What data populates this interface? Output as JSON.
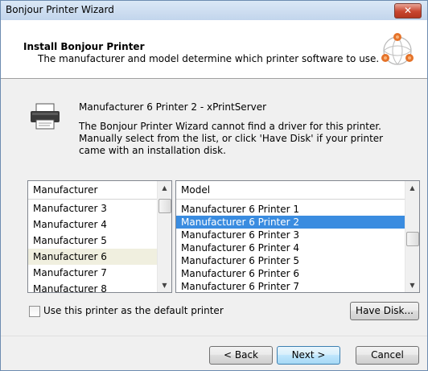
{
  "window": {
    "title": "Bonjour Printer Wizard",
    "close_label": "✕"
  },
  "header": {
    "title": "Install Bonjour Printer",
    "subtitle": "The manufacturer and model determine which printer software to use."
  },
  "printer": {
    "name": "Manufacturer 6 Printer 2 - xPrintServer",
    "description": "The Bonjour Printer Wizard cannot find a driver for this printer.  Manually select from the list, or click 'Have Disk' if your printer came with an installation disk."
  },
  "manufacturer_list": {
    "header": "Manufacturer",
    "items": [
      "Manufacturer 3",
      "Manufacturer 4",
      "Manufacturer 5",
      "Manufacturer 6",
      "Manufacturer 7",
      "Manufacturer 8"
    ],
    "selected": "Manufacturer 6"
  },
  "model_list": {
    "header": "Model",
    "items": [
      "Manufacturer 6 Printer 1",
      "Manufacturer 6 Printer 2",
      "Manufacturer 6 Printer 3",
      "Manufacturer 6 Printer 4",
      "Manufacturer 6 Printer 5",
      "Manufacturer 6 Printer 6",
      "Manufacturer 6 Printer 7"
    ],
    "selected": "Manufacturer 6 Printer 2"
  },
  "default_printer": {
    "label": "Use this printer as the default printer",
    "checked": false
  },
  "buttons": {
    "have_disk": "Have Disk...",
    "back": "< Back",
    "next": "Next >",
    "cancel": "Cancel"
  },
  "colors": {
    "selection": "#3a8ce0",
    "manufacturer_selection": "#f0efdf",
    "close_button": "#c8452f"
  }
}
